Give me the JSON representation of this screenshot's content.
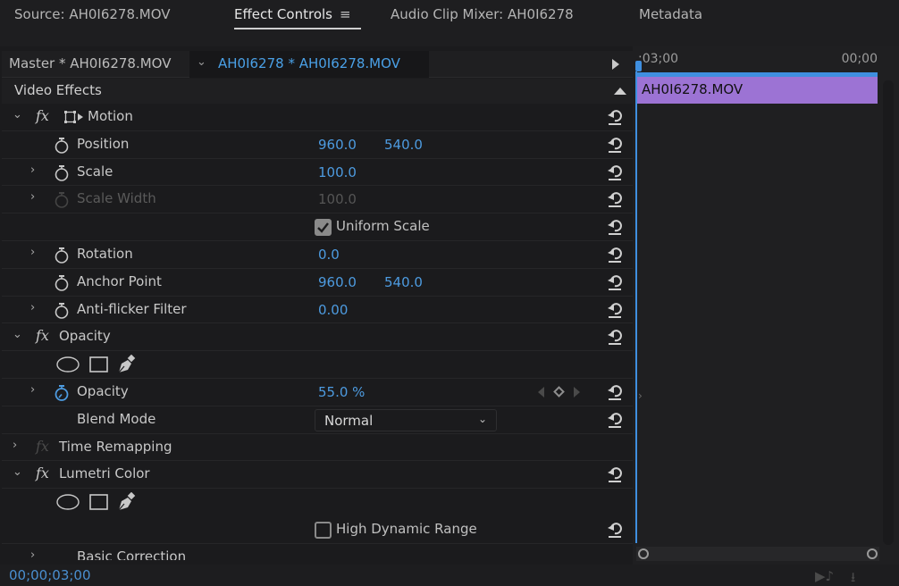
{
  "tabs": [
    {
      "label": "Source: AH0I6278.MOV",
      "active": false
    },
    {
      "label": "Effect Controls",
      "active": true,
      "menu_icon": "≡"
    },
    {
      "label": "Audio Clip Mixer: AH0I6278",
      "active": false
    },
    {
      "label": "Metadata",
      "active": false
    }
  ],
  "clip_header": {
    "master": "Master * AH0I6278.MOV",
    "sequence_clip": "AH0I6278 * AH0I6278.MOV"
  },
  "section_title": "Video Effects",
  "effects": {
    "motion": {
      "label": "Motion",
      "properties": {
        "position": {
          "label": "Position",
          "x": "960.0",
          "y": "540.0"
        },
        "scale": {
          "label": "Scale",
          "value": "100.0"
        },
        "scale_width": {
          "label": "Scale Width",
          "value": "100.0"
        },
        "uniform_scale": {
          "label": "Uniform Scale",
          "checked": true
        },
        "rotation": {
          "label": "Rotation",
          "value": "0.0"
        },
        "anchor_point": {
          "label": "Anchor Point",
          "x": "960.0",
          "y": "540.0"
        },
        "anti_flicker": {
          "label": "Anti-flicker Filter",
          "value": "0.00"
        }
      }
    },
    "opacity": {
      "label": "Opacity",
      "properties": {
        "opacity": {
          "label": "Opacity",
          "value": "55.0 %"
        },
        "blend_mode": {
          "label": "Blend Mode",
          "value": "Normal"
        }
      }
    },
    "time_remapping": {
      "label": "Time Remapping"
    },
    "lumetri": {
      "label": "Lumetri Color",
      "properties": {
        "hdr": {
          "label": "High Dynamic Range",
          "checked": false
        },
        "basic_correction": {
          "label": "Basic Correction"
        }
      }
    }
  },
  "fx_glyph": "fx",
  "timeline": {
    "start_time": ";03;00",
    "end_time": "00;00",
    "clip_name": "AH0I6278.MOV",
    "clip_color": "#9c73d4",
    "playhead_color": "#3f8fe0"
  },
  "status": {
    "timecode": "00;00;03;00"
  },
  "colors": {
    "value_blue": "#4d9be0",
    "background": "#1b1b1d"
  }
}
